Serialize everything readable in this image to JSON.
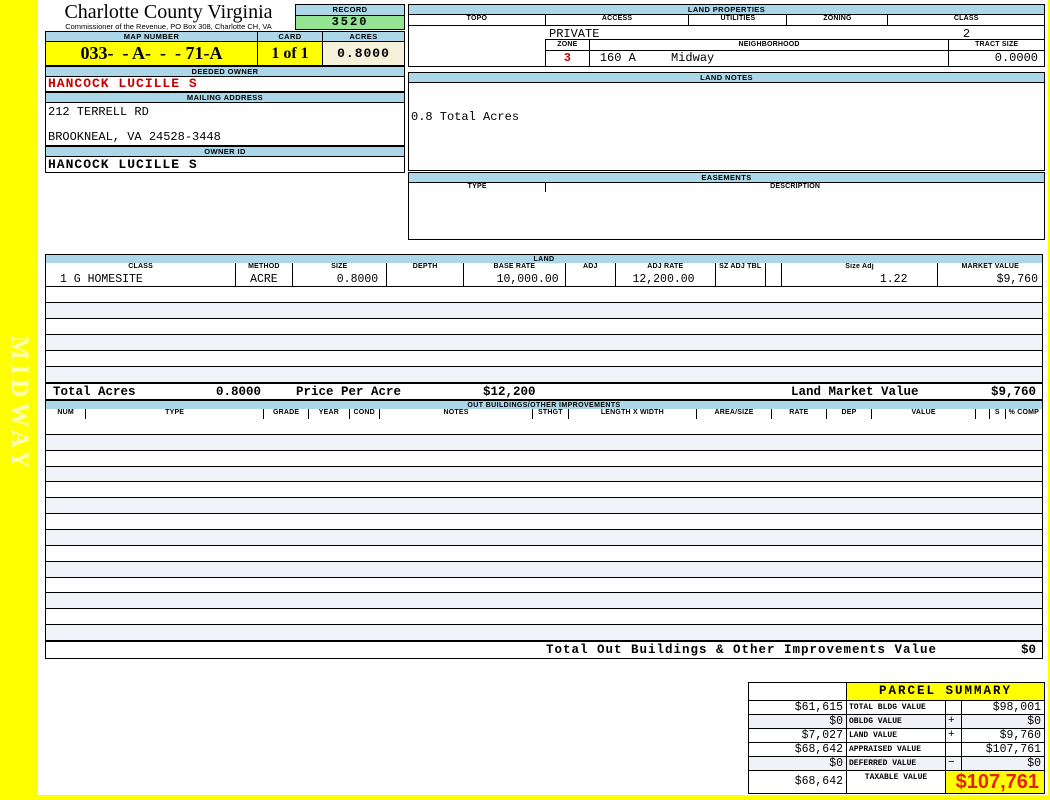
{
  "header": {
    "county_title": "Charlotte County Virginia",
    "commissioner_line": "Commissioner of the Revenue, PO Box 308, Charlotte CH, VA",
    "record_label": "RECORD",
    "record_value": "3520",
    "map_number_label": "MAP NUMBER",
    "map_number_value": "033-  - A-  -  - 71-A",
    "card_label": "CARD",
    "card_value": "1 of 1",
    "acres_label": "ACRES",
    "acres_value": "0.8000"
  },
  "owner": {
    "deeded_owner_label": "DEEDED OWNER",
    "deeded_owner_value": "HANCOCK LUCILLE S",
    "mailing_address_label": "MAILING ADDRESS",
    "address_line1": "212 TERRELL RD",
    "address_line2": "BROOKNEAL, VA 24528-3448",
    "owner_id_label": "OWNER ID",
    "owner_id_value": "HANCOCK LUCILLE S"
  },
  "land_properties": {
    "title": "LAND PROPERTIES",
    "columns": [
      "TOPO",
      "ACCESS",
      "UTILITIES",
      "ZONING",
      "CLASS"
    ],
    "access_value": "PRIVATE",
    "class_value": "2",
    "zone_label": "ZONE",
    "zone_value": "3",
    "neighborhood_label": "NEIGHBORHOOD",
    "neighborhood_code": "160 A",
    "neighborhood_name": "Midway",
    "tract_size_label": "TRACT SIZE",
    "tract_size_value": "0.0000"
  },
  "land_notes": {
    "title": "LAND NOTES",
    "note": "0.8 Total Acres"
  },
  "easements": {
    "title": "EASEMENTS",
    "type_label": "TYPE",
    "description_label": "DESCRIPTION"
  },
  "land_table": {
    "title": "LAND",
    "columns": [
      "CLASS",
      "METHOD",
      "SIZE",
      "DEPTH",
      "BASE RATE",
      "ADJ",
      "ADJ RATE",
      "SZ ADJ TBL",
      "",
      "Size Adj",
      "MARKET VALUE"
    ],
    "row": {
      "class": "1 G HOMESITE",
      "method": "ACRE",
      "size": "0.8000",
      "depth": "",
      "base_rate": "10,000.00",
      "adj": "",
      "adj_rate": "12,200.00",
      "sz_adj_tbl": "",
      "size_adj": "1.22",
      "market_value": "$9,760"
    },
    "totals": {
      "total_acres_label": "Total Acres",
      "total_acres_value": "0.8000",
      "price_per_acre_label": "Price Per Acre",
      "price_per_acre_value": "$12,200",
      "land_market_value_label": "Land Market Value",
      "land_market_value": "$9,760"
    }
  },
  "out_buildings": {
    "title": "OUT BUILDINGS/OTHER IMPROVEMENTS",
    "columns": [
      "NUM",
      "TYPE",
      "GRADE",
      "YEAR",
      "COND",
      "NOTES",
      "STHGT",
      "LENGTH X WIDTH",
      "AREA/SIZE",
      "RATE",
      "DEP",
      "VALUE",
      "",
      "S",
      "% COMP"
    ],
    "total_label": "Total Out Buildings & Other Improvements Value",
    "total_value": "$0"
  },
  "parcel_summary": {
    "title": "PARCEL SUMMARY",
    "rows": [
      {
        "prior": "$61,615",
        "label": "TOTAL BLDG VALUE",
        "op": "",
        "value": "$98,001"
      },
      {
        "prior": "$0",
        "label": "OBLDG VALUE",
        "op": "+",
        "value": "$0"
      },
      {
        "prior": "$7,027",
        "label": "LAND VALUE",
        "op": "+",
        "value": "$9,760"
      },
      {
        "prior": "$68,642",
        "label": "APPRAISED VALUE",
        "op": "",
        "value": "$107,761"
      },
      {
        "prior": "$0",
        "label": "DEFERRED VALUE",
        "op": "−",
        "value": "$0"
      }
    ],
    "taxable": {
      "prior": "$68,642",
      "label": "TAXABLE VALUE",
      "value": "$107,761"
    }
  },
  "sidebar": {
    "district_name": "MIDWAY"
  },
  "colors": {
    "page_yellow": "#FFFF00",
    "header_blue": "#ABD7E8",
    "record_green": "#93E493",
    "acres_cream": "#F5F1DA",
    "alt_row": "#F2F2FA",
    "owner_red": "#CC0000",
    "taxable_red": "#E32119"
  }
}
